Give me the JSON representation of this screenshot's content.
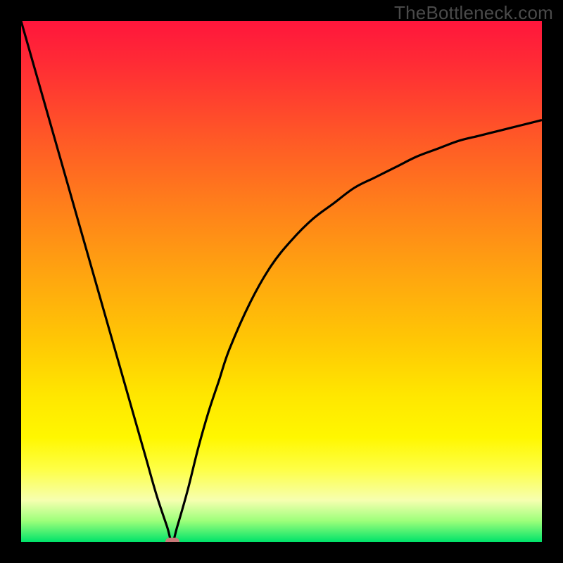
{
  "watermark": "TheBottleneck.com",
  "chart_data": {
    "type": "line",
    "title": "",
    "xlabel": "",
    "ylabel": "",
    "xlim": [
      0,
      100
    ],
    "ylim": [
      0,
      100
    ],
    "grid": false,
    "x": [
      0,
      2,
      4,
      6,
      8,
      10,
      12,
      14,
      16,
      18,
      20,
      22,
      24,
      26,
      28,
      29,
      30,
      32,
      34,
      36,
      38,
      40,
      44,
      48,
      52,
      56,
      60,
      64,
      68,
      72,
      76,
      80,
      84,
      88,
      92,
      96,
      100
    ],
    "y": [
      100,
      93,
      86,
      79,
      72,
      65,
      58,
      51,
      44,
      37,
      30,
      23,
      16,
      9,
      3,
      0,
      3,
      10,
      18,
      25,
      31,
      37,
      46,
      53,
      58,
      62,
      65,
      68,
      70,
      72,
      74,
      75.5,
      77,
      78,
      79,
      80,
      81
    ],
    "colors": {
      "curve": "#000000",
      "marker": "#c87878",
      "top": "#ff163c",
      "bottom": "#00e36a"
    },
    "min_point": {
      "x": 29,
      "y": 0
    }
  }
}
